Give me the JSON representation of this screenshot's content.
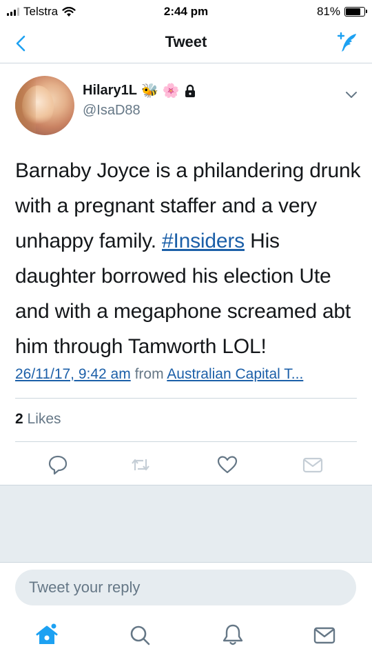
{
  "status_bar": {
    "carrier": "Telstra",
    "time": "2:44 pm",
    "battery": "81%",
    "battery_level": 0.81
  },
  "nav": {
    "title": "Tweet",
    "back_icon": "chevron-left-icon",
    "compose_icon": "compose-tweet-icon"
  },
  "tweet": {
    "display_name": "Hilary1L",
    "name_emojis": [
      "🐝",
      "🌸"
    ],
    "handle": "@IsaD88",
    "text_parts": {
      "before": "Barnaby Joyce is a philandering drunk with a pregnant staffer and a very unhappy family. ",
      "hashtag": "#Insiders",
      "after": " His daughter borrowed his election Ute and with a megaphone screamed abt him through Tamworth LOL!"
    },
    "timestamp": "26/11/17, 9:42 am",
    "from_label": "from",
    "location": "Australian Capital T...",
    "likes_count": "2",
    "likes_label": "Likes"
  },
  "reply": {
    "placeholder": "Tweet your reply"
  },
  "colors": {
    "accent": "#1da1f2",
    "link": "#1b5fa8",
    "secondary_text": "#657786",
    "divider": "#ccd6dd",
    "gray_panel": "#e6ecf0"
  }
}
